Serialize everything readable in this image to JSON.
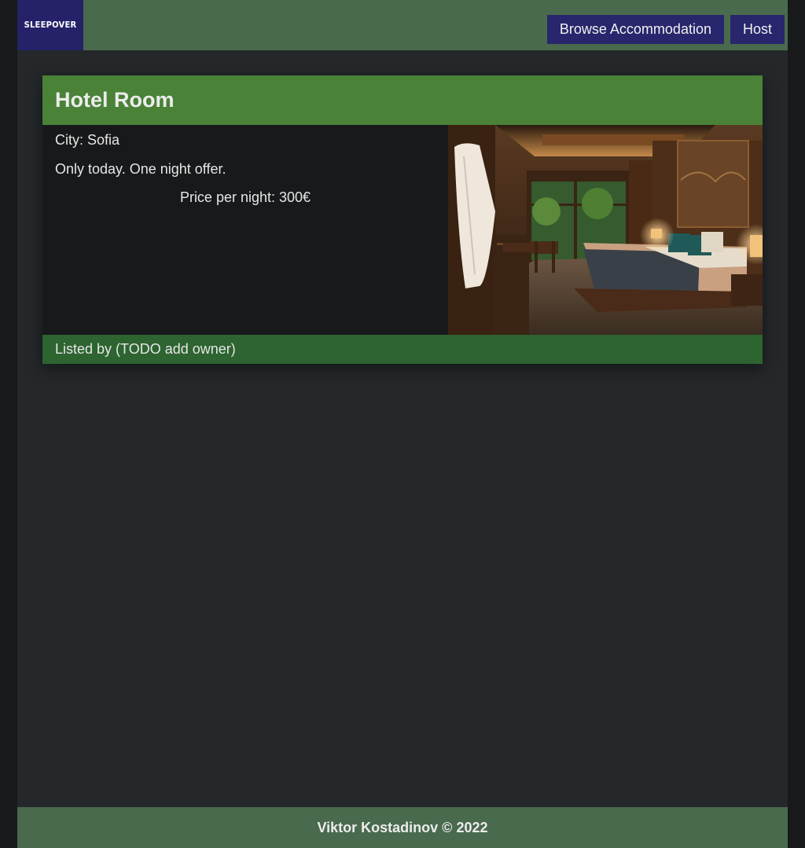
{
  "header": {
    "logo_text": "SLEEPOVER",
    "nav": [
      {
        "label": "Browse Accommodation"
      },
      {
        "label": "Host"
      }
    ]
  },
  "listing": {
    "title": "Hotel Room",
    "city": "City: Sofia",
    "description": "Only today. One night offer.",
    "price": "Price per night: 300€",
    "listed_by": "Listed by (TODO add owner)",
    "photo": "hotel-room-photo"
  },
  "footer": {
    "copyright": "Viktor Kostadinov © 2022"
  },
  "colors": {
    "header_bg": "#4a6a4e",
    "logo_bg": "#25226a",
    "nav_button_bg": "#28266c",
    "card_header_bg": "#4a8238",
    "card_footer_bg": "#2d6430",
    "page_bg": "#24282a"
  }
}
